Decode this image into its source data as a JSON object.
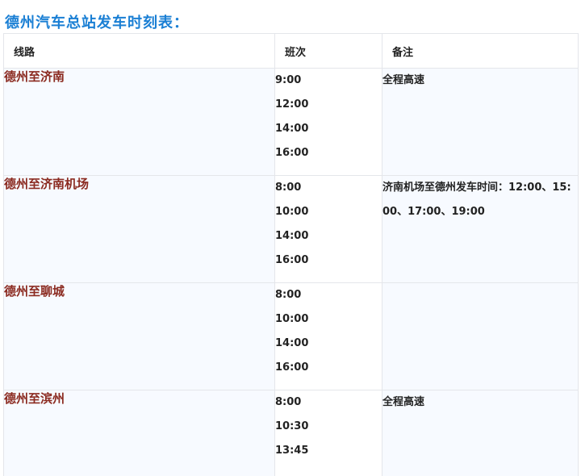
{
  "page": {
    "title": "德州汽车总站发车时刻表："
  },
  "table": {
    "headers": {
      "route": "线路",
      "times": "班次",
      "note": "备注"
    },
    "rows": [
      {
        "route": "德州至济南",
        "times": [
          "9:00",
          "12:00",
          "14:00",
          "16:00"
        ],
        "note": "全程高速"
      },
      {
        "route": "德州至济南机场",
        "times": [
          "8:00",
          "10:00",
          "14:00",
          "16:00"
        ],
        "note": "济南机场至德州发车时间：12:00、15:00、17:00、19:00"
      },
      {
        "route": "德州至聊城",
        "times": [
          "8:00",
          "10:00",
          "14:00",
          "16:00"
        ],
        "note": ""
      },
      {
        "route": "德州至滨州",
        "times": [
          "8:00",
          "10:30",
          "13:45"
        ],
        "note": "全程高速"
      }
    ]
  }
}
